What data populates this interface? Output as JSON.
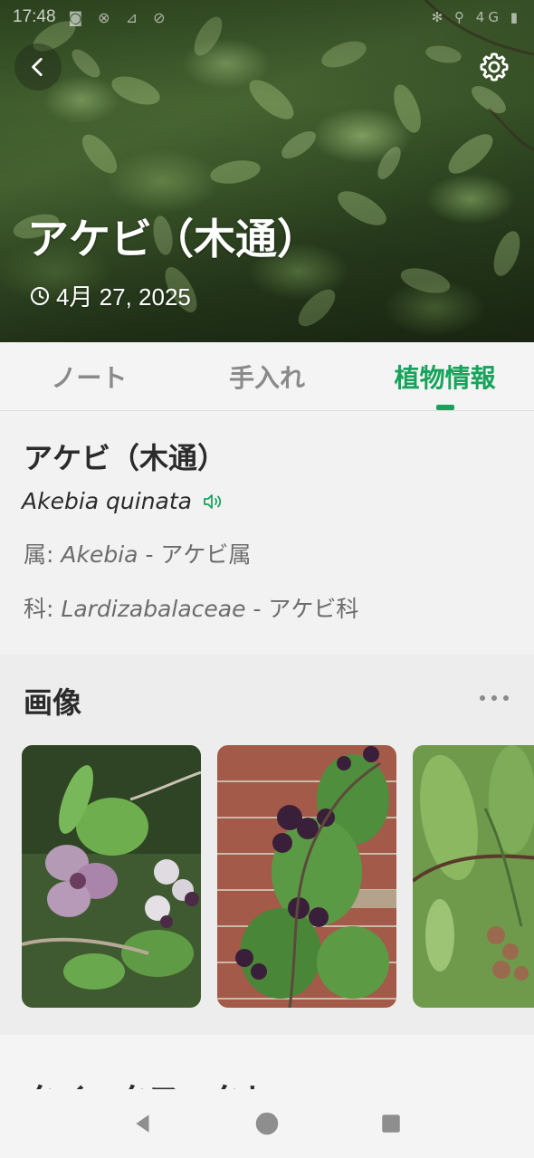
{
  "status_bar": {
    "time": "17:48",
    "icons_left": "◙ ⊗ ⊿ ⊘",
    "icons_right": "✻ ⚲ 4G ▮"
  },
  "hero": {
    "title": "アケビ（木通）",
    "date": "4月 27, 2025"
  },
  "tabs": [
    {
      "label": "ノート"
    },
    {
      "label": "手入れ"
    },
    {
      "label": "植物情報"
    }
  ],
  "active_tab": "植物情報",
  "plant": {
    "name": "アケビ（木通）",
    "scientific_name": "Akebia quinata",
    "genus_label": "属",
    "genus_separator": ":",
    "genus_latin": "Akebia",
    "genus_jp": "- アケビ属",
    "family_label": "科",
    "family_separator": ":",
    "family_latin": "Lardizabalaceae",
    "family_jp": "- アケビ科"
  },
  "images_section": {
    "title": "画像",
    "more_label": "•••"
  },
  "next_section": {
    "title": "クイックファクト"
  },
  "colors": {
    "accent": "#17a35c",
    "text_dark": "#2b2b2b",
    "text_muted": "#6c6c6c",
    "tab_inactive": "#8a8a8a"
  },
  "icons": [
    "back-arrow-icon",
    "gear-icon",
    "clock-icon",
    "speaker-icon",
    "more-dots-icon",
    "nav-back-icon",
    "nav-home-icon",
    "nav-recents-icon"
  ]
}
